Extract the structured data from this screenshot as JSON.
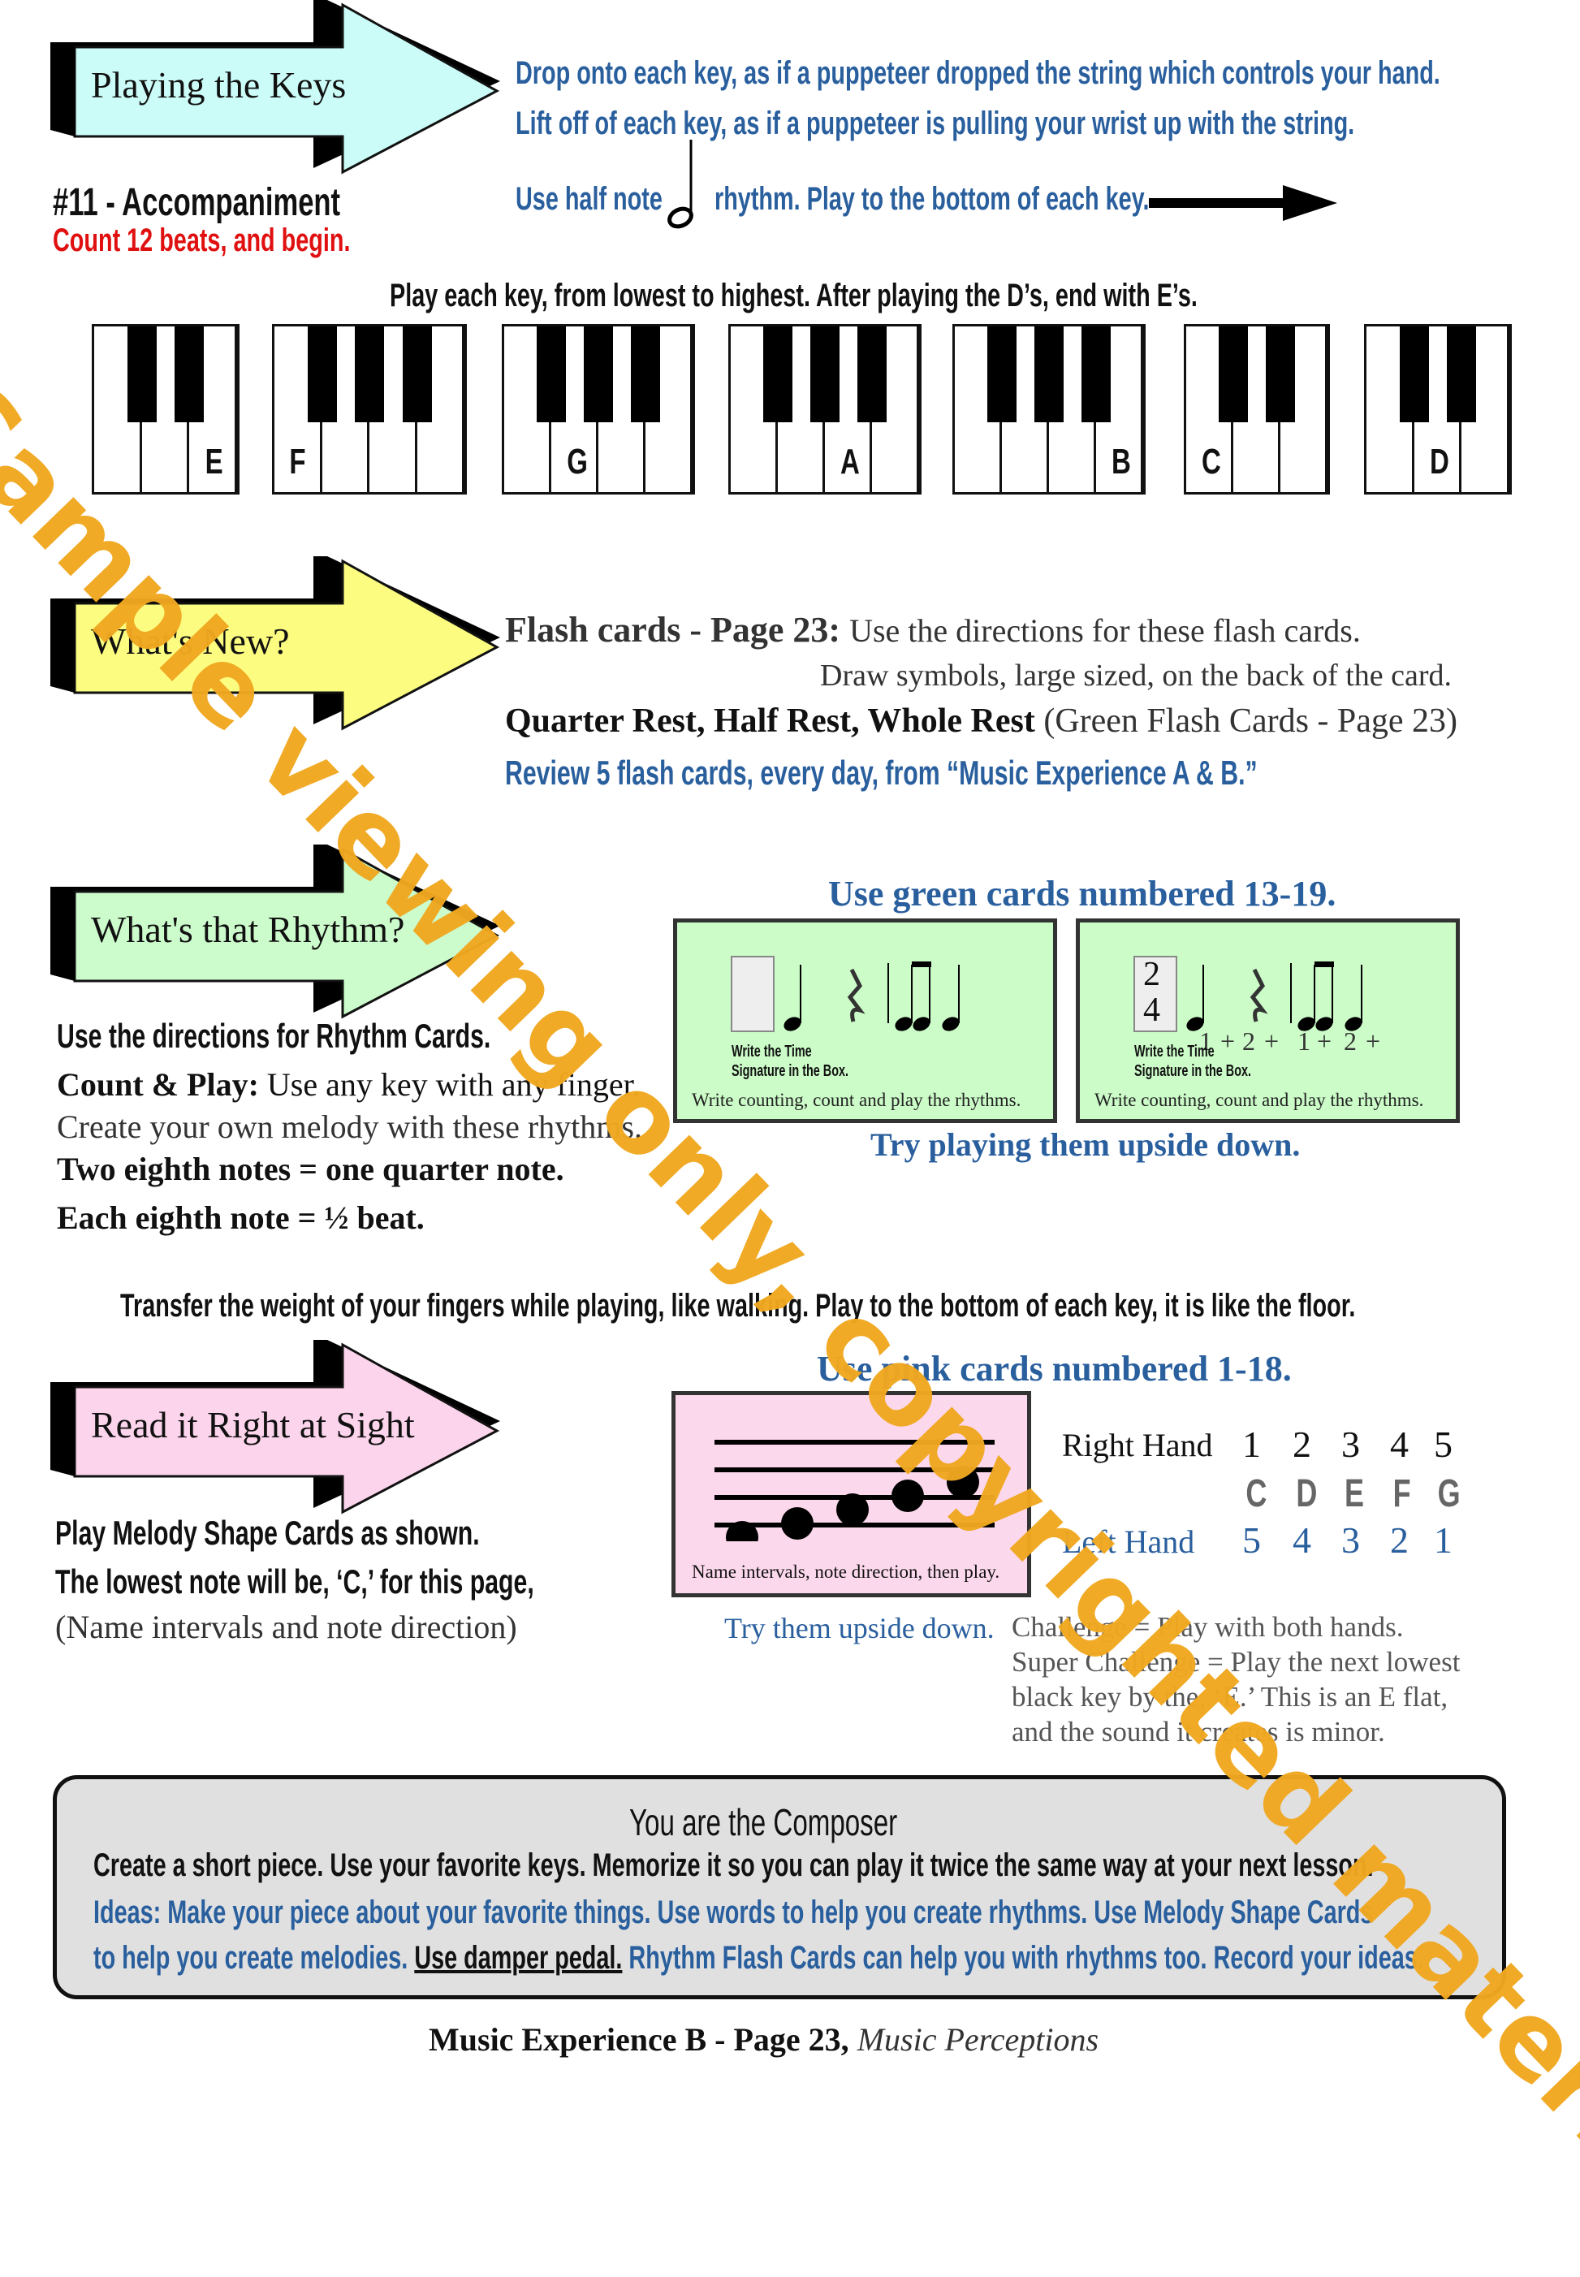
{
  "header": {
    "arrow_label": "Playing the Keys",
    "lesson_title": "#11 - Accompaniment",
    "count_in": "Count 12 beats, and begin.",
    "instructions": [
      "Drop onto each key, as if a puppeteer dropped the string which controls your hand.",
      "Lift off of each key, as if a puppeteer is pulling your wrist up with the string."
    ],
    "rhythm_pre": "Use half note",
    "rhythm_post": "rhythm. Play to the bottom of each key.",
    "note_icon": "half-note-icon",
    "arrow_icon": "right-arrow-icon"
  },
  "keys": {
    "direction": "Play each key, from lowest to highest. After playing the D’s, end with E’s.",
    "groups": [
      {
        "label": "E",
        "whites": 3,
        "index": 2
      },
      {
        "label": "F",
        "whites": 4,
        "index": 0
      },
      {
        "label": "G",
        "whites": 4,
        "index": 1
      },
      {
        "label": "A",
        "whites": 4,
        "index": 2
      },
      {
        "label": "B",
        "whites": 4,
        "index": 3
      },
      {
        "label": "C",
        "whites": 3,
        "index": 0
      },
      {
        "label": "D",
        "whites": 3,
        "index": 1
      }
    ]
  },
  "whats_new": {
    "arrow_label": "What's New?",
    "flash_title": "Flash cards - Page 23:",
    "flash_text": "Use the directions for these flash cards.",
    "draw": "Draw symbols, large sized, on the back of the card.",
    "rests": "Quarter Rest, Half Rest, Whole Rest",
    "rests_note": "(Green Flash Cards - Page 23)",
    "review": "Review 5 flash cards, every day, from “Music Experience A & B.”"
  },
  "rhythm": {
    "arrow_label": "What's that Rhythm?",
    "lines": [
      "Use the directions for Rhythm Cards."
    ],
    "count_play_bold": "Count & Play:",
    "count_play": "Use any key with any finger.",
    "create": "Create your own melody with these rhythms.",
    "eighth1": "Two eighth notes = one quarter note.",
    "eighth2": "Each eighth note = ½ beat.",
    "cards_title": "Use green cards numbered 13-19.",
    "card_write_time": "Write the Time",
    "card_signature": "Signature in the Box.",
    "card_caption": "Write counting, count and play the rhythms.",
    "time_sig": [
      "2",
      "4"
    ],
    "counting": [
      "1",
      "+",
      "2",
      "+",
      "1",
      "+",
      "2",
      "+"
    ],
    "upside": "Try playing them upside down."
  },
  "transfer": "Transfer the weight of your fingers while playing, like walking. Play to the bottom of each key, it is like the floor.",
  "sight": {
    "arrow_label": "Read it Right at Sight",
    "pink_title": "Use pink cards numbered 1-18.",
    "lines": [
      "Play Melody Shape Cards as shown.",
      "The lowest note will be, ‘C,’ for this page,",
      "(Name intervals and note direction)"
    ],
    "card_caption": "Name intervals, note direction, then play.",
    "right_hand": "Right Hand",
    "rh_fingers": [
      "1",
      "2",
      "3",
      "4",
      "5"
    ],
    "notes": [
      "C",
      "D",
      "E",
      "F",
      "G"
    ],
    "left_hand": "Left Hand",
    "lh_fingers": [
      "5",
      "4",
      "3",
      "2",
      "1"
    ],
    "upside": "Try them upside down.",
    "challenge": [
      "Challenge = Play with both hands.",
      "Super Challenge = Play the next lowest",
      "black key by the, ‘E.’ This is an E flat,",
      "and the sound it creates is minor."
    ]
  },
  "composer": {
    "title": "You are the Composer",
    "line1": "Create a short piece. Use your favorite keys. Memorize it so you can play it twice the same  way at your next lesson.",
    "line2": "Ideas: Make your piece about your favorite things. Use words to help you create rhythms. Use Melody Shape Cards",
    "line3_a": "to help you create melodies.",
    "line3_u": "Use damper pedal.",
    "line3_b": "Rhythm Flash Cards can help you with rhythms too. Record your ideas."
  },
  "footer": {
    "bold": "Music Experience B - Page 23,",
    "italic": "Music Perceptions"
  },
  "watermark": "Sample viewing only, copyrighted material.",
  "colors": {
    "arrow1": "#ccfcf8",
    "arrow2": "#fcfc80",
    "arrow3": "#ccfccc",
    "arrow4": "#fcd4ec",
    "accent_blue": "#2a5f9e",
    "red": "#e01010",
    "watermark": "#f0a820"
  }
}
